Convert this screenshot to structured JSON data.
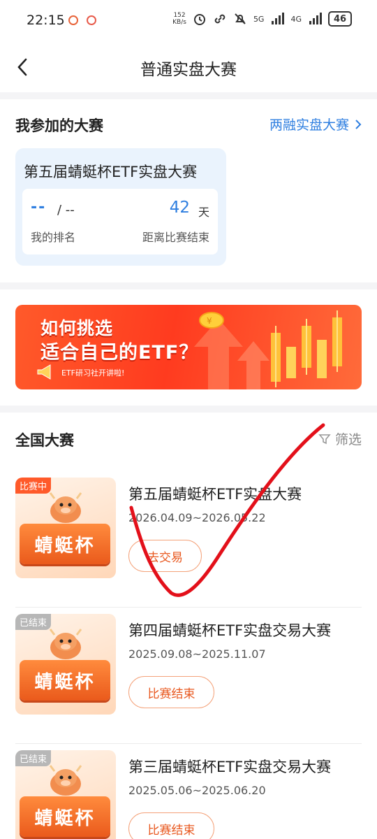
{
  "status_bar": {
    "time": "22:15",
    "network_speed": "152",
    "network_unit": "KB/s",
    "signal_5g": "5G",
    "signal_4g": "4G",
    "battery": "46"
  },
  "header": {
    "title": "普通实盘大赛"
  },
  "my_contests": {
    "title": "我参加的大赛",
    "margin_link": "两融实盘大赛",
    "card": {
      "name": "第五届蜻蜓杯ETF实盘大赛",
      "rank_value": "--",
      "rank_total": "/ --",
      "rank_label": "我的排名",
      "days_value": "42",
      "days_unit": "天",
      "days_label": "距离比赛结束"
    }
  },
  "banner": {
    "line1": "如何挑选",
    "line2": "适合自己的ETF？",
    "sub": "ETF研习社开讲啦!"
  },
  "national": {
    "title": "全国大赛",
    "filter_label": "筛选",
    "thumb_text": "蜻蜓杯",
    "contests": [
      {
        "badge": "比赛中",
        "name": "第五届蜻蜓杯ETF实盘大赛",
        "dates": "2026.04.09~2026.05.22",
        "button": "去交易"
      },
      {
        "badge": "已结束",
        "name": "第四届蜻蜓杯ETF实盘交易大赛",
        "dates": "2025.09.08~2025.11.07",
        "button": "比赛结束"
      },
      {
        "badge": "已结束",
        "name": "第三届蜻蜓杯ETF实盘交易大赛",
        "dates": "2025.05.06~2025.06.20",
        "button": "比赛结束"
      }
    ]
  },
  "colors": {
    "accent_blue": "#2f7fe0",
    "accent_orange": "#e8581f",
    "badge_active": "#ff5a2a",
    "badge_ended": "#b7b7b7",
    "annotation_red": "#e3101a"
  }
}
